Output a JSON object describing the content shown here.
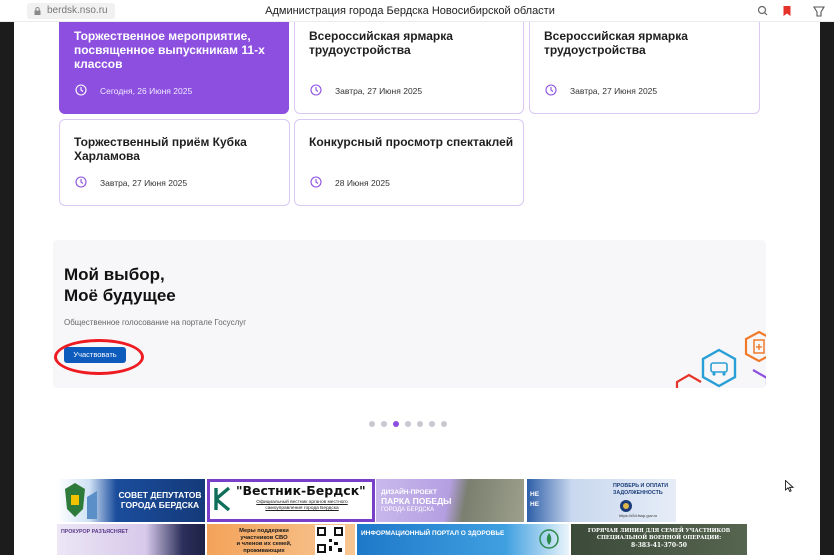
{
  "browser": {
    "url": "berdsk.nso.ru",
    "title": "Администрация города Бердска Новосибирской области"
  },
  "events": [
    {
      "title": "Торжественное мероприятие, посвященное выпускникам 11-х классов",
      "date": "Сегодня, 26 Июня 2025"
    },
    {
      "title": "Всероссийская ярмарка трудоустройства",
      "date": "Завтра, 27 Июня 2025"
    },
    {
      "title": "Всероссийская ярмарка трудоустройства",
      "date": "Завтра, 27 Июня 2025"
    },
    {
      "title": "Торжественный приём Кубка Харламова",
      "date": "Завтра, 27 Июня 2025"
    },
    {
      "title": "Конкурсный просмотр спектаклей",
      "date": "28 Июня 2025"
    }
  ],
  "banner": {
    "title_line1": "Мой выбор,",
    "title_line2": "Моё будущее",
    "subtitle": "Общественное голосование на портале Госуслуг",
    "button_label": "Участвовать"
  },
  "pagination": {
    "count": 7,
    "active_index": 2
  },
  "partners": {
    "council_line1": "СОВЕТ ДЕПУТАТОВ",
    "council_line2": "ГОРОДА БЕРДСКА",
    "vestnik_title": "\"Вестник-Бердск\"",
    "vestnik_sub1": "Официальный вестник органов местного",
    "vestnik_sub2": "самоуправления города Бердска",
    "park_line1": "ДИЗАЙН-ПРОЕКТ",
    "park_line2": "ПАРКА ПОБЕДЫ",
    "park_line3": "ГОРОДА БЕРДСКА",
    "debt_line1": "НЕ",
    "debt_line2": "НЕ",
    "debt_title1": "ПРОВЕРЬ И ОПЛАТИ",
    "debt_title2": "ЗАДОЛЖЕННОСТЬ",
    "debt_url": "https://r54.fssp.gov.ru",
    "prosecutor": "ПРОКУРОР РАЗЪЯСНЯЕТ",
    "svo_line1": "Меры поддержки",
    "svo_line2": "участников СВО",
    "svo_line3": "и членов их семей,",
    "svo_line4": "проживающих",
    "health": "ИНФОРМАЦИОННЫЙ ПОРТАЛ О ЗДОРОВЬЕ",
    "hotline1": "ГОРЯЧАЯ ЛИНИЯ ДЛЯ СЕМЕЙ УЧАСТНИКОВ",
    "hotline2": "СПЕЦИАЛЬНОЙ ВОЕННОЙ ОПЕРАЦИИ:",
    "hotline3": "8-383-41-370-50"
  },
  "colors": {
    "accent": "#8c4fe0",
    "button": "#0c5bbd",
    "highlight": "#ee1b22"
  }
}
